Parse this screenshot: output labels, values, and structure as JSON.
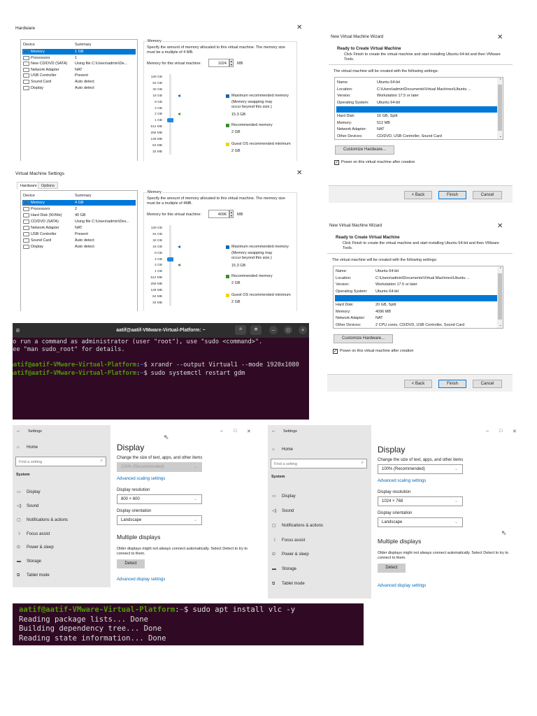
{
  "hardware_dialog": {
    "title": "Hardware",
    "columns": [
      "Device",
      "Summary"
    ],
    "devices": [
      {
        "name": "Memory",
        "summary": "1 GB"
      },
      {
        "name": "Processors",
        "summary": "1"
      },
      {
        "name": "New CD/DVD (SATA)",
        "summary": "Using file C:\\Users\\admin\\De..."
      },
      {
        "name": "Network Adapter",
        "summary": "NAT"
      },
      {
        "name": "USB Controller",
        "summary": "Present"
      },
      {
        "name": "Sound Card",
        "summary": "Auto detect"
      },
      {
        "name": "Display",
        "summary": "Auto detect"
      }
    ],
    "selected_device": 0,
    "memory": {
      "group_title": "Memory",
      "description": "Specify the amount of memory allocated to this virtual machine. The memory size must be a multiple of 4 MB.",
      "field_label": "Memory for this virtual machine:",
      "value": "1024",
      "unit": "MB",
      "scale": [
        "128 GB",
        "64 GB",
        "32 GB",
        "16 GB",
        "8 GB",
        "4 GB",
        "2 GB",
        "1 GB",
        "512 MB",
        "256 MB",
        "128 MB",
        "64 MB",
        "32 MB"
      ],
      "selected_scale": "1 GB",
      "max_marker": "16 GB",
      "rec_marker": "2 GB",
      "legend": {
        "max_label": "Maximum recommended memory",
        "max_note": "(Memory swapping may occur beyond this size.)",
        "max_value": "15.3 GB",
        "rec_label": "Recommended memory",
        "rec_value": "2 GB",
        "min_label": "Guest OS recommended minimum",
        "min_value": "2 GB"
      }
    }
  },
  "vm_settings": {
    "title": "Virtual Machine Settings",
    "tabs": [
      "Hardware",
      "Options"
    ],
    "columns": [
      "Device",
      "Summary"
    ],
    "devices": [
      {
        "name": "Memory",
        "summary": "4 GB"
      },
      {
        "name": "Processors",
        "summary": "2"
      },
      {
        "name": "Hard Disk (NVMe)",
        "summary": "40 GB"
      },
      {
        "name": "CD/DVD (SATA)",
        "summary": "Using file C:\\Users\\admin\\Des..."
      },
      {
        "name": "Network Adapter",
        "summary": "NAT"
      },
      {
        "name": "USB Controller",
        "summary": "Present"
      },
      {
        "name": "Sound Card",
        "summary": "Auto detect"
      },
      {
        "name": "Display",
        "summary": "Auto detect"
      }
    ],
    "selected_device": 0,
    "memory": {
      "group_title": "Memory",
      "description": "Specify the amount of memory allocated to this virtual machine. The memory size must be a multiple of 4MB.",
      "field_label": "Memory for this virtual machine:",
      "value": "4096",
      "unit": "MB",
      "scale": [
        "128 GB",
        "64 GB",
        "32 GB",
        "16 GB",
        "8 GB",
        "4 GB",
        "2 GB",
        "1 GB",
        "512 MB",
        "256 MB",
        "128 MB",
        "64 MB",
        "32 MB"
      ],
      "selected_scale": "4 GB",
      "max_marker": "16 GB",
      "rec_marker": "2 GB",
      "legend": {
        "max_label": "Maximum recommended memory",
        "max_note": "(Memory swapping may occur beyond this size.)",
        "max_value": "15.3 GB",
        "rec_label": "Recommended memory",
        "rec_value": "2 GB",
        "min_label": "Guest OS recommended minimum",
        "min_value": "2 GB"
      }
    }
  },
  "wizard_1": {
    "title": "New Virtual Machine Wizard",
    "heading": "Ready to Create Virtual Machine",
    "subheading": "Click Finish to create the virtual machine and start installing Ubuntu 64-bit and then VMware Tools.",
    "intro": "The virtual machine will be created with the following settings:",
    "rows_top": [
      {
        "k": "Name:",
        "v": "Ubuntu 64-bit"
      },
      {
        "k": "Location:",
        "v": "C:\\Users\\admin\\Documents\\Virtual Machines\\Ubuntu ..."
      },
      {
        "k": "Version:",
        "v": "Workstation 17.5 or later"
      },
      {
        "k": "Operating System:",
        "v": "Ubuntu 64-bit"
      }
    ],
    "rows_bottom": [
      {
        "k": "Hard Disk:",
        "v": "16 GB, Split"
      },
      {
        "k": "Memory:",
        "v": "512 MB"
      },
      {
        "k": "Network Adapter:",
        "v": "NAT"
      },
      {
        "k": "Other Devices:",
        "v": "CD/DVD, USB Controller, Sound Card"
      }
    ],
    "customize": "Customize Hardware...",
    "power_on": "Power on this virtual machine after creation",
    "power_on_checked": true,
    "back": "< Back",
    "finish": "Finish",
    "cancel": "Cancel"
  },
  "wizard_2": {
    "title": "New Virtual Machine Wizard",
    "heading": "Ready to Create Virtual Machine",
    "subheading": "Click Finish to create the virtual machine and start installing Ubuntu 64-bit and then VMware Tools.",
    "intro": "The virtual machine will be created with the following settings:",
    "rows_top": [
      {
        "k": "Name:",
        "v": "Ubuntu 64-bit"
      },
      {
        "k": "Location:",
        "v": "C:\\Users\\admin\\Documents\\Virtual Machines\\Ubuntu ..."
      },
      {
        "k": "Version:",
        "v": "Workstation 17.5 or later"
      },
      {
        "k": "Operating System:",
        "v": "Ubuntu 64-bit"
      }
    ],
    "rows_bottom": [
      {
        "k": "Hard Disk:",
        "v": "20 GB, Split"
      },
      {
        "k": "Memory:",
        "v": "4096 MB"
      },
      {
        "k": "Network Adapter:",
        "v": "NAT"
      },
      {
        "k": "Other Devices:",
        "v": "2 CPU cores, CD/DVD, USB Controller, Sound Card"
      }
    ],
    "customize": "Customize Hardware...",
    "power_on": "Power on this virtual machine after creation",
    "power_on_checked": true,
    "back": "< Back",
    "finish": "Finish",
    "cancel": "Cancel"
  },
  "terminal_1": {
    "title": "aatif@aatif-VMware-Virtual-Platform: ~",
    "info_lines": [
      "To run a command as administrator (user \"root\"), use \"sudo <command>\".",
      "See \"man sudo_root\" for details."
    ],
    "prompt_user": "aatif@aatif-VMware-Virtual-Platform",
    "prompt_path": "~",
    "prompt_sign": "$",
    "commands": [
      "xrandr --output Virtual1 --mode 1920x1080",
      "sudo systemctl restart gdm"
    ]
  },
  "settings_1": {
    "app_title": "Settings",
    "home": "Home",
    "search_placeholder": "Find a setting",
    "section": "System",
    "nav": [
      {
        "label": "Display",
        "icon": "▭"
      },
      {
        "label": "Sound",
        "icon": "◁)"
      },
      {
        "label": "Notifications & actions",
        "icon": "▢"
      },
      {
        "label": "Focus assist",
        "icon": "☽"
      },
      {
        "label": "Power & sleep",
        "icon": "⏻"
      },
      {
        "label": "Storage",
        "icon": "▬"
      },
      {
        "label": "Tablet mode",
        "icon": "⧉"
      }
    ],
    "page_title": "Display",
    "scale_label": "Change the size of text, apps, and other items",
    "scale_value": "100% (Recommended)",
    "scale_disabled": true,
    "adv_scaling": "Advanced scaling settings",
    "res_label": "Display resolution",
    "res_value": "800 × 600",
    "orient_label": "Display orientation",
    "orient_value": "Landscape",
    "multi_title": "Multiple displays",
    "multi_desc": "Older displays might not always connect automatically. Select Detect to try to connect to them.",
    "detect": "Detect",
    "adv_display": "Advanced display settings"
  },
  "settings_2": {
    "app_title": "Settings",
    "home": "Home",
    "search_placeholder": "Find a setting",
    "section": "System",
    "nav": [
      {
        "label": "Display",
        "icon": "▭"
      },
      {
        "label": "Sound",
        "icon": "◁)"
      },
      {
        "label": "Notifications & actions",
        "icon": "▢"
      },
      {
        "label": "Focus assist",
        "icon": "☽"
      },
      {
        "label": "Power & sleep",
        "icon": "⏻"
      },
      {
        "label": "Storage",
        "icon": "▬"
      },
      {
        "label": "Tablet mode",
        "icon": "⧉"
      }
    ],
    "page_title": "Display",
    "scale_label": "Change the size of text, apps, and other items",
    "scale_value": "100% (Recommended)",
    "scale_disabled": false,
    "adv_scaling": "Advanced scaling settings",
    "res_label": "Display resolution",
    "res_value": "1024 × 768",
    "orient_label": "Display orientation",
    "orient_value": "Landscape",
    "multi_title": "Multiple displays",
    "multi_desc": "Older displays might not always connect automatically. Select Detect to try to connect to them.",
    "detect": "Detect",
    "adv_display": "Advanced display settings"
  },
  "terminal_2": {
    "prompt_user": "aatif@aatif-VMware-Virtual-Platform",
    "prompt_path": "~",
    "prompt_sign": "$",
    "command": "sudo apt install vlc -y",
    "output": [
      "Reading package lists... Done",
      "Building dependency tree... Done",
      "Reading state information... Done"
    ]
  },
  "colors": {
    "accent": "#0078d7",
    "terminal_bg": "#300a24",
    "prompt_green": "#4e9a06",
    "link": "#0067b8",
    "max_marker": "#1565b0",
    "rec_marker": "#3c8d2f",
    "min_marker": "#f5d300"
  }
}
